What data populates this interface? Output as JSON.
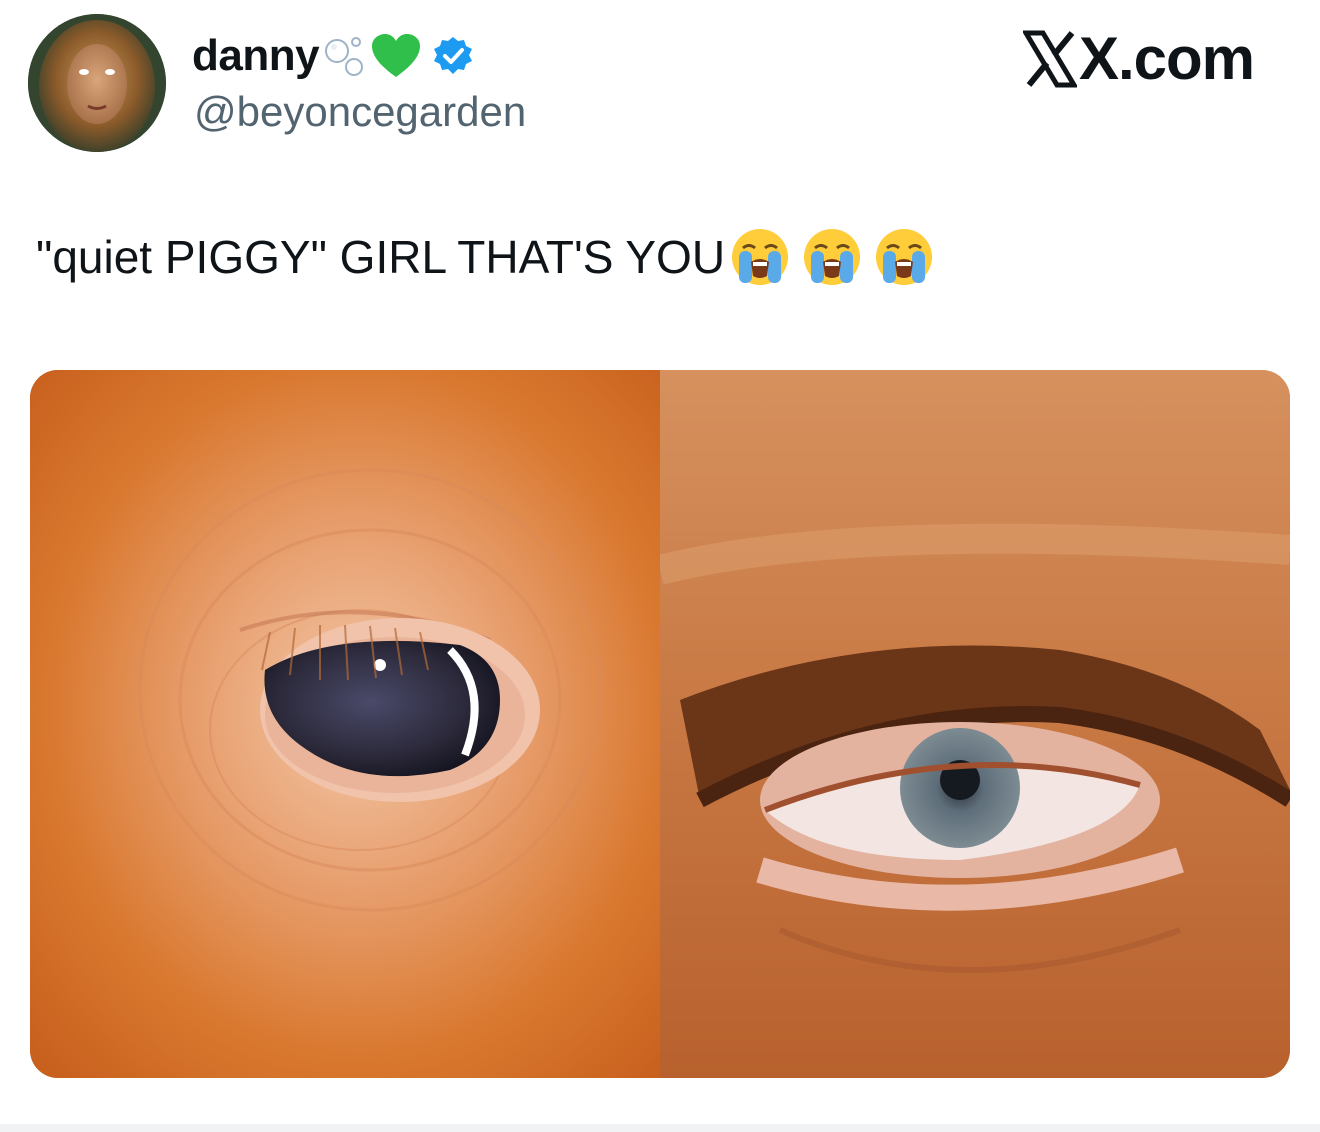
{
  "author": {
    "display_name": "danny",
    "handle": "@beyoncegarden",
    "avatar_icon": "profile-photo",
    "name_decorations": [
      "bubbles-icon",
      "green-heart-icon",
      "verified-badge-icon"
    ],
    "verified_color": "#1d9bf0",
    "heart_color": "#2fbf4a"
  },
  "site_watermark": "X.com",
  "post": {
    "text": "\"quiet PIGGY\" GIRL THAT'S YOU",
    "emojis": [
      "loudly-crying-face",
      "loudly-crying-face",
      "loudly-crying-face"
    ]
  },
  "media": {
    "left_image": "pig-eye-closeup",
    "right_image": "human-eye-closeup"
  }
}
